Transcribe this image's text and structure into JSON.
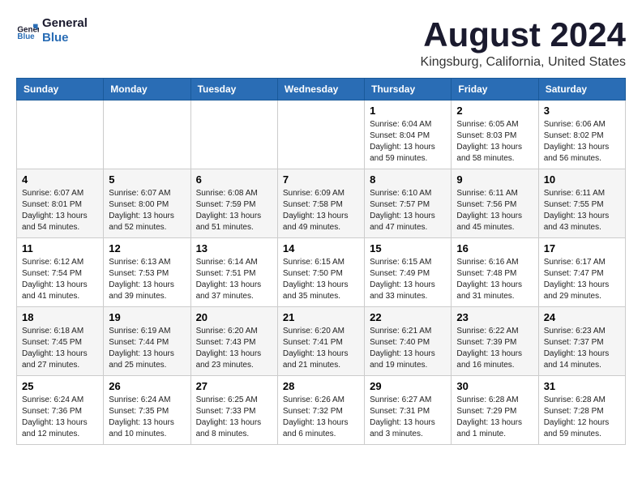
{
  "header": {
    "logo_line1": "General",
    "logo_line2": "Blue",
    "main_title": "August 2024",
    "subtitle": "Kingsburg, California, United States"
  },
  "calendar": {
    "days_of_week": [
      "Sunday",
      "Monday",
      "Tuesday",
      "Wednesday",
      "Thursday",
      "Friday",
      "Saturday"
    ],
    "weeks": [
      [
        {
          "date": "",
          "info": ""
        },
        {
          "date": "",
          "info": ""
        },
        {
          "date": "",
          "info": ""
        },
        {
          "date": "",
          "info": ""
        },
        {
          "date": "1",
          "info": "Sunrise: 6:04 AM\nSunset: 8:04 PM\nDaylight: 13 hours\nand 59 minutes."
        },
        {
          "date": "2",
          "info": "Sunrise: 6:05 AM\nSunset: 8:03 PM\nDaylight: 13 hours\nand 58 minutes."
        },
        {
          "date": "3",
          "info": "Sunrise: 6:06 AM\nSunset: 8:02 PM\nDaylight: 13 hours\nand 56 minutes."
        }
      ],
      [
        {
          "date": "4",
          "info": "Sunrise: 6:07 AM\nSunset: 8:01 PM\nDaylight: 13 hours\nand 54 minutes."
        },
        {
          "date": "5",
          "info": "Sunrise: 6:07 AM\nSunset: 8:00 PM\nDaylight: 13 hours\nand 52 minutes."
        },
        {
          "date": "6",
          "info": "Sunrise: 6:08 AM\nSunset: 7:59 PM\nDaylight: 13 hours\nand 51 minutes."
        },
        {
          "date": "7",
          "info": "Sunrise: 6:09 AM\nSunset: 7:58 PM\nDaylight: 13 hours\nand 49 minutes."
        },
        {
          "date": "8",
          "info": "Sunrise: 6:10 AM\nSunset: 7:57 PM\nDaylight: 13 hours\nand 47 minutes."
        },
        {
          "date": "9",
          "info": "Sunrise: 6:11 AM\nSunset: 7:56 PM\nDaylight: 13 hours\nand 45 minutes."
        },
        {
          "date": "10",
          "info": "Sunrise: 6:11 AM\nSunset: 7:55 PM\nDaylight: 13 hours\nand 43 minutes."
        }
      ],
      [
        {
          "date": "11",
          "info": "Sunrise: 6:12 AM\nSunset: 7:54 PM\nDaylight: 13 hours\nand 41 minutes."
        },
        {
          "date": "12",
          "info": "Sunrise: 6:13 AM\nSunset: 7:53 PM\nDaylight: 13 hours\nand 39 minutes."
        },
        {
          "date": "13",
          "info": "Sunrise: 6:14 AM\nSunset: 7:51 PM\nDaylight: 13 hours\nand 37 minutes."
        },
        {
          "date": "14",
          "info": "Sunrise: 6:15 AM\nSunset: 7:50 PM\nDaylight: 13 hours\nand 35 minutes."
        },
        {
          "date": "15",
          "info": "Sunrise: 6:15 AM\nSunset: 7:49 PM\nDaylight: 13 hours\nand 33 minutes."
        },
        {
          "date": "16",
          "info": "Sunrise: 6:16 AM\nSunset: 7:48 PM\nDaylight: 13 hours\nand 31 minutes."
        },
        {
          "date": "17",
          "info": "Sunrise: 6:17 AM\nSunset: 7:47 PM\nDaylight: 13 hours\nand 29 minutes."
        }
      ],
      [
        {
          "date": "18",
          "info": "Sunrise: 6:18 AM\nSunset: 7:45 PM\nDaylight: 13 hours\nand 27 minutes."
        },
        {
          "date": "19",
          "info": "Sunrise: 6:19 AM\nSunset: 7:44 PM\nDaylight: 13 hours\nand 25 minutes."
        },
        {
          "date": "20",
          "info": "Sunrise: 6:20 AM\nSunset: 7:43 PM\nDaylight: 13 hours\nand 23 minutes."
        },
        {
          "date": "21",
          "info": "Sunrise: 6:20 AM\nSunset: 7:41 PM\nDaylight: 13 hours\nand 21 minutes."
        },
        {
          "date": "22",
          "info": "Sunrise: 6:21 AM\nSunset: 7:40 PM\nDaylight: 13 hours\nand 19 minutes."
        },
        {
          "date": "23",
          "info": "Sunrise: 6:22 AM\nSunset: 7:39 PM\nDaylight: 13 hours\nand 16 minutes."
        },
        {
          "date": "24",
          "info": "Sunrise: 6:23 AM\nSunset: 7:37 PM\nDaylight: 13 hours\nand 14 minutes."
        }
      ],
      [
        {
          "date": "25",
          "info": "Sunrise: 6:24 AM\nSunset: 7:36 PM\nDaylight: 13 hours\nand 12 minutes."
        },
        {
          "date": "26",
          "info": "Sunrise: 6:24 AM\nSunset: 7:35 PM\nDaylight: 13 hours\nand 10 minutes."
        },
        {
          "date": "27",
          "info": "Sunrise: 6:25 AM\nSunset: 7:33 PM\nDaylight: 13 hours\nand 8 minutes."
        },
        {
          "date": "28",
          "info": "Sunrise: 6:26 AM\nSunset: 7:32 PM\nDaylight: 13 hours\nand 6 minutes."
        },
        {
          "date": "29",
          "info": "Sunrise: 6:27 AM\nSunset: 7:31 PM\nDaylight: 13 hours\nand 3 minutes."
        },
        {
          "date": "30",
          "info": "Sunrise: 6:28 AM\nSunset: 7:29 PM\nDaylight: 13 hours\nand 1 minute."
        },
        {
          "date": "31",
          "info": "Sunrise: 6:28 AM\nSunset: 7:28 PM\nDaylight: 12 hours\nand 59 minutes."
        }
      ]
    ]
  }
}
